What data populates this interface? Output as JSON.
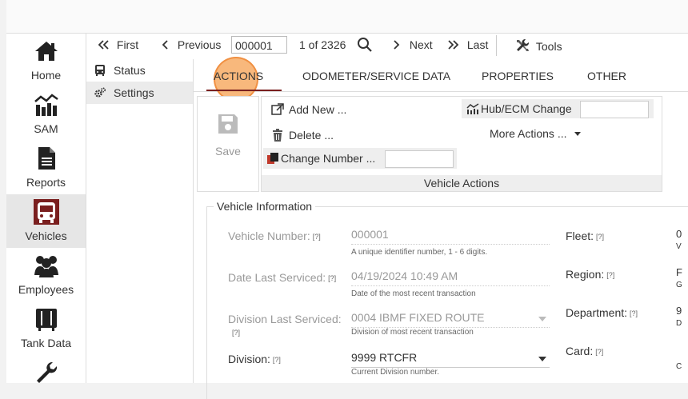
{
  "nav": {
    "items": [
      {
        "label": "Home",
        "icon": "home-icon"
      },
      {
        "label": "SAM",
        "icon": "sam-chart-icon"
      },
      {
        "label": "Reports",
        "icon": "report-icon"
      },
      {
        "label": "Vehicles",
        "icon": "bus-icon"
      },
      {
        "label": "Employees",
        "icon": "employees-icon"
      },
      {
        "label": "Tank Data",
        "icon": "tank-icon"
      },
      {
        "label": "",
        "icon": "wrench-icon"
      }
    ],
    "active_index": 3
  },
  "toolbar": {
    "first": "First",
    "previous": "Previous",
    "record_number": "000001",
    "record_position": "1 of 2326",
    "next": "Next",
    "last": "Last",
    "tools": "Tools"
  },
  "subnav": {
    "items": [
      {
        "label": "Status",
        "icon": "bus-small-icon"
      },
      {
        "label": "Settings",
        "icon": "gears-icon"
      }
    ]
  },
  "tabs": [
    "ACTIONS",
    "ODOMETER/SERVICE DATA",
    "PROPERTIES",
    "OTHER"
  ],
  "actions": {
    "save": "Save",
    "add_new": "Add New ...",
    "delete": "Delete ...",
    "change_number": "Change Number ...",
    "hub_change": "Hub/ECM Change",
    "more_actions": "More Actions ...",
    "group_title": "Vehicle Actions"
  },
  "vehicle_info": {
    "legend": "Vehicle Information",
    "vehicle_number": {
      "label": "Vehicle Number:",
      "value": "000001",
      "hint": "A unique identifier number, 1 - 6 digits."
    },
    "date_last_serviced": {
      "label": "Date Last Serviced:",
      "value": "04/19/2024 10:49 AM",
      "hint": "Date of the most recent transaction"
    },
    "division_last_serviced": {
      "label": "Division Last Serviced:",
      "value": "0004 IBMF FIXED ROUTE",
      "hint": "Division of most recent transaction"
    },
    "division": {
      "label": "Division:",
      "value": "9999 RTCFR",
      "hint": "Current Division number."
    },
    "help_mark": "[?]",
    "fleet": {
      "label": "Fleet:",
      "clip_value": "0",
      "clip_hint": "V"
    },
    "region": {
      "label": "Region:",
      "clip_value": "F",
      "clip_hint": "G"
    },
    "department": {
      "label": "Department:",
      "clip_value": "9",
      "clip_hint": "D"
    },
    "card": {
      "label": "Card:",
      "clip_hint": "C"
    }
  },
  "colors": {
    "accent": "#7a1f1f",
    "highlight": "#f5a050"
  }
}
